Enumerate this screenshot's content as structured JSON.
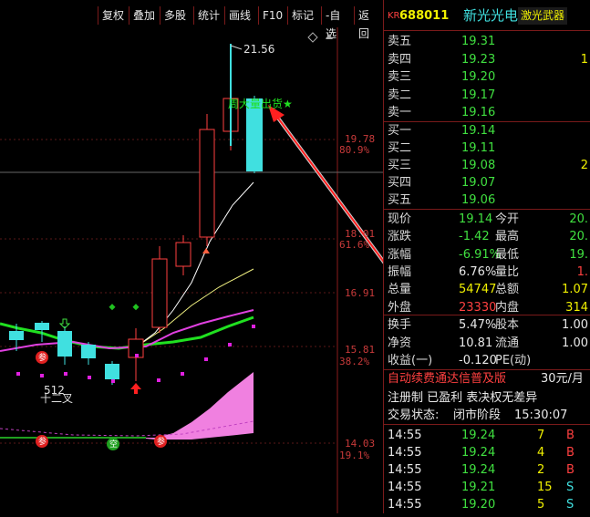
{
  "toolbar": {
    "buttons": [
      "复权",
      "叠加",
      "多股",
      "统计",
      "画线",
      "F10",
      "标记",
      "-自选",
      "返回"
    ]
  },
  "chart": {
    "high_label": "21.56",
    "annotation": "周大量出货★",
    "bottom_label": "512",
    "bottom_label2": "十二叉",
    "price_axis": [
      {
        "price": "19.78",
        "pct": "80.9%"
      },
      {
        "price": "18.01",
        "pct": "61.6%"
      },
      {
        "price": "16.91",
        "pct": ""
      },
      {
        "price": "15.81",
        "pct": "38.2%"
      },
      {
        "price": "14.03",
        "pct": "19.1%"
      }
    ],
    "badge_labels": {
      "can": "参",
      "kong": "空"
    }
  },
  "quote": {
    "code_prefix": "KR",
    "code": "688011",
    "name": "新光光电",
    "tag": "激光武器",
    "asks": [
      {
        "label": "卖五",
        "price": "19.31",
        "vol": ""
      },
      {
        "label": "卖四",
        "price": "19.23",
        "vol": "1"
      },
      {
        "label": "卖三",
        "price": "19.20",
        "vol": ""
      },
      {
        "label": "卖二",
        "price": "19.17",
        "vol": ""
      },
      {
        "label": "卖一",
        "price": "19.16",
        "vol": ""
      }
    ],
    "bids": [
      {
        "label": "买一",
        "price": "19.14",
        "vol": ""
      },
      {
        "label": "买二",
        "price": "19.11",
        "vol": ""
      },
      {
        "label": "买三",
        "price": "19.08",
        "vol": "2"
      },
      {
        "label": "买四",
        "price": "19.07",
        "vol": ""
      },
      {
        "label": "买五",
        "price": "19.06",
        "vol": ""
      }
    ],
    "stats": [
      {
        "l1": "现价",
        "v1": "19.14",
        "l2": "今开",
        "v2": "20."
      },
      {
        "l1": "涨跌",
        "v1": "-1.42",
        "l2": "最高",
        "v2": "20."
      },
      {
        "l1": "涨幅",
        "v1": "-6.91%",
        "l2": "最低",
        "v2": "19."
      },
      {
        "l1": "振幅",
        "v1": "6.76%",
        "l2": "量比",
        "v2": "1."
      },
      {
        "l1": "总量",
        "v1": "54747",
        "l2": "总额",
        "v2": "1.07"
      },
      {
        "l1": "外盘",
        "v1": "23330",
        "l2": "内盘",
        "v2": "314"
      }
    ],
    "fin": [
      {
        "l1": "换手",
        "v1": "5.47%",
        "l2": "股本",
        "v2": "1.00"
      },
      {
        "l1": "净资",
        "v1": "10.81",
        "l2": "流通",
        "v2": "1.00"
      },
      {
        "l1": "收益(一)",
        "v1": "-0.120",
        "l2": "PE(动)",
        "v2": ""
      }
    ],
    "ad1": "自动续费通达信普及版",
    "ad1_price": "30元/月",
    "ad2": "注册制 已盈利 表决权无差异",
    "status_label": "交易状态:",
    "status_value": "闭市阶段",
    "status_time": "15:30:07",
    "ticks": [
      {
        "time": "14:55",
        "price": "19.24",
        "vol": "7",
        "side": "B"
      },
      {
        "time": "14:55",
        "price": "19.24",
        "vol": "4",
        "side": "B"
      },
      {
        "time": "14:55",
        "price": "19.24",
        "vol": "2",
        "side": "B"
      },
      {
        "time": "14:55",
        "price": "19.21",
        "vol": "15",
        "side": "S"
      },
      {
        "time": "14:55",
        "price": "19.20",
        "vol": "5",
        "side": "S"
      }
    ]
  },
  "colors": {
    "up": "#ff4040",
    "down": "#40e0e0",
    "ma5": "#ffffff",
    "ma10": "#f0f080",
    "ma20": "#e040e0",
    "ma_green": "#20e020"
  }
}
